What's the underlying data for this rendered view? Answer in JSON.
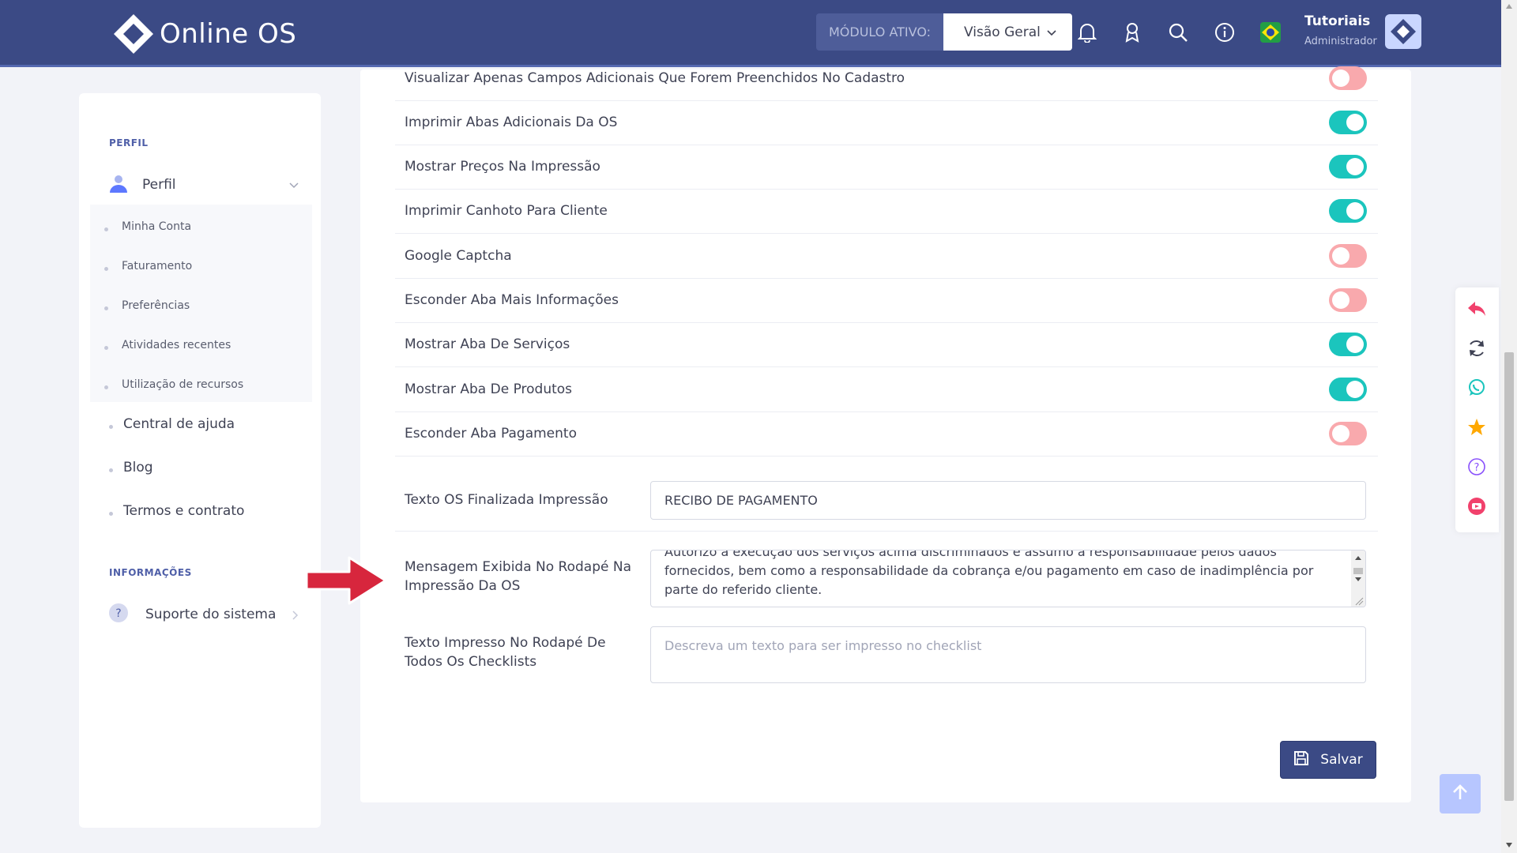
{
  "header": {
    "app_name": "Online OS",
    "module_label": "MÓDULO ATIVO:",
    "module_value": "Visão Geral",
    "icons": [
      "bell-icon",
      "badge-icon",
      "search-icon",
      "info-icon",
      "brazil-flag-icon"
    ],
    "user_name": "Tutoriais",
    "user_role": "Administrador"
  },
  "sidebar": {
    "section_profile": "PERFIL",
    "profile_label": "Perfil",
    "sub_items": [
      "Minha Conta",
      "Faturamento",
      "Preferências",
      "Atividades recentes",
      "Utilização de recursos"
    ],
    "links": [
      "Central de ajuda",
      "Blog",
      "Termos e contrato"
    ],
    "section_info": "INFORMAÇÕES",
    "support_label": "Suporte do sistema"
  },
  "settings": {
    "toggles": [
      {
        "label": "Visualizar Apenas Campos Adicionais Que Forem Preenchidos No Cadastro",
        "on": false
      },
      {
        "label": "Imprimir Abas Adicionais Da OS",
        "on": true
      },
      {
        "label": "Mostrar Preços Na Impressão",
        "on": true
      },
      {
        "label": "Imprimir Canhoto Para Cliente",
        "on": true
      },
      {
        "label": "Google Captcha",
        "on": false
      },
      {
        "label": "Esconder Aba Mais Informações",
        "on": false
      },
      {
        "label": "Mostrar Aba De Serviços",
        "on": true
      },
      {
        "label": "Mostrar Aba De Produtos",
        "on": true
      },
      {
        "label": "Esconder Aba Pagamento",
        "on": false
      }
    ],
    "finalized_label": "Texto OS Finalizada Impressão",
    "finalized_value": "RECIBO DE PAGAMENTO",
    "footer_msg_label": "Mensagem Exibida No Rodapé Na Impressão Da OS",
    "footer_msg_value": "Autorizo a execução dos serviços acima discriminados e assumo a responsabilidade pelos dados fornecidos, bem como a responsabilidade da cobrança e/ou pagamento em caso de inadimplência por parte do referido cliente.",
    "checklist_label": "Texto Impresso No Rodapé De Todos Os Checklists",
    "checklist_placeholder": "Descreva um texto para ser impresso no checklist",
    "save_label": "Salvar"
  },
  "colors": {
    "header_bg": "#3b4a85",
    "toggle_on": "#1bc5bd",
    "toggle_off": "#f9a9ad",
    "arrow": "#d7263d"
  }
}
